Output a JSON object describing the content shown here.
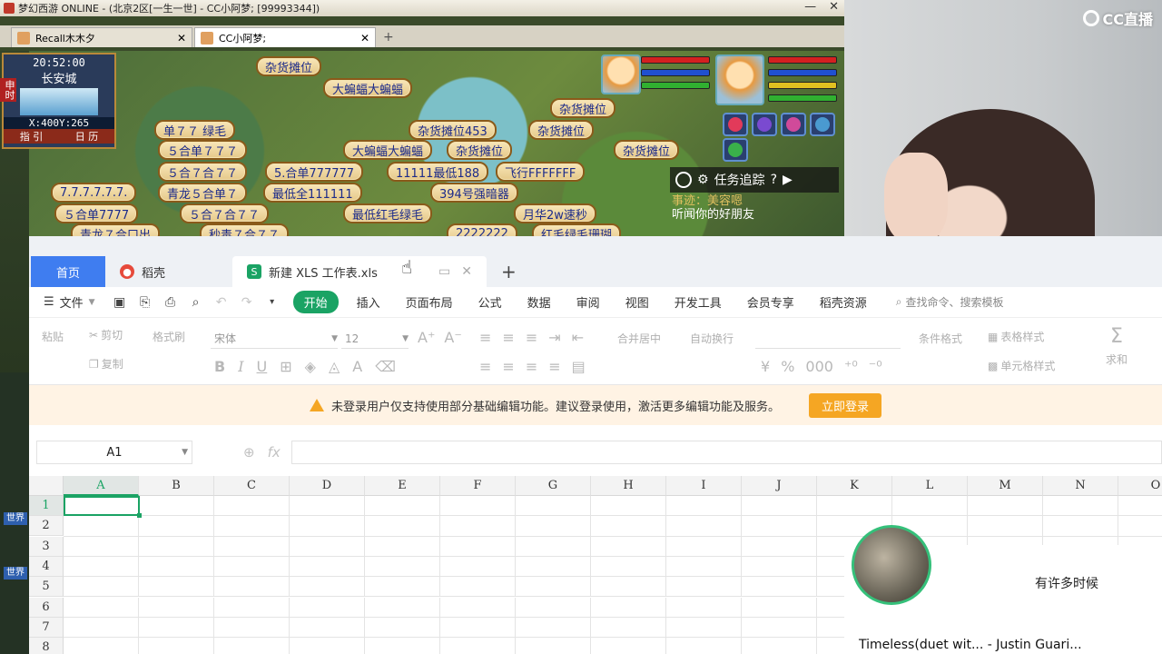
{
  "game": {
    "title": "梦幻西游 ONLINE - (北京2区[一生一世] - CC小阿梦; [99993344])",
    "tabs": [
      {
        "label": "Recall木木夕"
      },
      {
        "label": "CC小阿梦;"
      }
    ],
    "minimap": {
      "time": "20:52:00",
      "city": "长安城",
      "coord": "X:400Y:265",
      "link_1": "指 引",
      "link_2": "日 历",
      "side": "申时"
    },
    "stalls": [
      "杂货摊位",
      "大蝙蝠大蝙蝠",
      "杂货摊位",
      "单７７  绿毛",
      "杂货摊位453",
      "杂货摊位",
      "５合单７７７",
      "大蝙蝠大蝙蝠",
      "杂货摊位",
      "杂货摊位",
      "５合７合７７",
      "5.合单777777",
      "11111最低188",
      "飞行FFFFFFF",
      "7.7.7.7.7.7.",
      "青龙５合单７",
      "最低全111111",
      "394号强暗器",
      "５合单7777",
      "５合７合７７",
      "最低红毛绿毛",
      "月华2w速秒",
      "青龙７合口出",
      "秒毒７合７７",
      "2222222",
      "红毛绿毛珊瑚"
    ],
    "quest": {
      "title": "任务追踪",
      "help": "?",
      "line_1": "事迹：美容嗯",
      "line_2": "听闻你的好朋友"
    },
    "chips": [
      "世界",
      "世界"
    ]
  },
  "cam": {
    "logo": "CC直播"
  },
  "wps": {
    "tabs": {
      "home": "首页",
      "daoke": "稻壳",
      "doc": "新建 XLS 工作表.xls",
      "new": "+"
    },
    "menubar": {
      "file": "文件",
      "items": [
        "开始",
        "插入",
        "页面布局",
        "公式",
        "数据",
        "审阅",
        "视图",
        "开发工具",
        "会员专享",
        "稻壳资源"
      ],
      "search": "查找命令、搜索模板"
    },
    "ribbon": {
      "paste": "粘贴",
      "cut": "剪切",
      "copy": "复制",
      "format_painter": "格式刷",
      "font": "宋体",
      "size": "12",
      "merge": "合并居中",
      "wrap": "自动换行",
      "table_style": "表格样式",
      "cond_format": "条件格式",
      "cell_style": "单元格样式",
      "sum": "求和"
    },
    "notice": {
      "text": "未登录用户仅支持使用部分基础编辑功能。建议登录使用，激活更多编辑功能及服务。",
      "button": "立即登录"
    },
    "formula": {
      "cell_ref": "A1",
      "fx": "fx"
    },
    "columns": [
      "A",
      "B",
      "C",
      "D",
      "E",
      "F",
      "G",
      "H",
      "I",
      "J",
      "K",
      "L",
      "M",
      "N",
      "O"
    ],
    "rows": [
      "1",
      "2",
      "3",
      "4",
      "5",
      "6",
      "7",
      "8"
    ]
  },
  "music": {
    "lyric": "有许多时候",
    "song": "Timeless(duet wit... - Justin Guari..."
  }
}
